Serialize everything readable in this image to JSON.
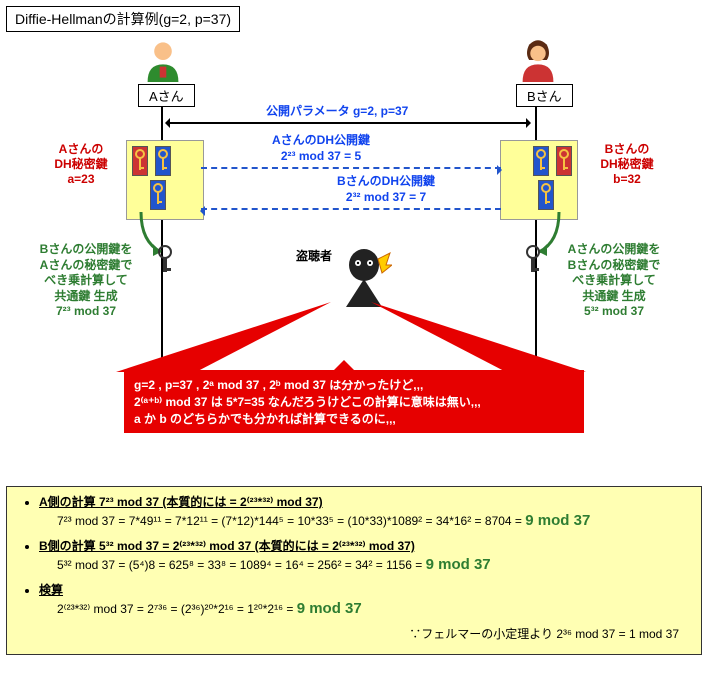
{
  "title": "Diffie-Hellmanの計算例(g=2, p=37)",
  "a_name": "Aさん",
  "b_name": "Bさん",
  "params": "公開パラメータ g=2, p=37",
  "a_sec_l1": "Aさんの",
  "a_sec_l2": "DH秘密鍵",
  "a_sec_l3": "a=23",
  "b_sec_l1": "Bさんの",
  "b_sec_l2": "DH秘密鍵",
  "b_sec_l3": "b=32",
  "a_pub_t": "AさんのDH公開鍵",
  "a_pub_v": "2²³ mod 37 = 5",
  "b_pub_t": "BさんのDH公開鍵",
  "b_pub_v": "2³² mod 37 = 7",
  "a_gen_l1": "Bさんの公開鍵を",
  "a_gen_l2": "Aさんの秘密鍵で",
  "a_gen_l3": "べき乗計算して",
  "a_gen_l4": "共通鍵 生成",
  "a_gen_v": "7²³ mod 37",
  "b_gen_l1": "Aさんの公開鍵を",
  "b_gen_l2": "Bさんの秘密鍵で",
  "b_gen_l3": "べき乗計算して",
  "b_gen_l4": "共通鍵 生成",
  "b_gen_v": "5³² mod 37",
  "eaves": "盗聴者",
  "bub_l1": "g=2 , p=37 , 2ᵃ mod 37 , 2ᵇ mod 37 は分かったけど,,,",
  "bub_l2": "2⁽ᵃ⁺ᵇ⁾ mod 37 は 5*7=35 なんだろうけどこの計算に意味は無い,,,",
  "bub_l3": "a か b のどちらかでも分かれば計算できるのに,,,",
  "calc_a_hd": "A側の計算 7²³ mod 37 (本質的には = 2⁽²³*³²⁾ mod 37)",
  "calc_a_eq": "7²³ mod 37 = 7*49¹¹ = 7*12¹¹ = (7*12)*144⁵ = 10*33⁵ = (10*33)*1089² = 34*16² = 8704 = ",
  "calc_a_ans": "9 mod 37",
  "calc_b_hd": "B側の計算 5³² mod 37 = 2⁽²³*³²⁾ mod 37 (本質的には = 2⁽²³*³²⁾ mod 37)",
  "calc_b_eq": "5³² mod 37 = (5⁴)8 = 625⁸ = 33⁸ = 1089⁴ = 16⁴ = 256² = 34² = 1156 = ",
  "calc_b_ans": "9 mod 37",
  "calc_c_hd": "検算",
  "calc_c_eq": "2⁽²³*³²⁾ mod 37 = 2⁷³⁶ = (2³⁶)²⁰*2¹⁶ = 1²⁰*2¹⁶ = ",
  "calc_c_ans": "9 mod 37",
  "fermat": "∵フェルマーの小定理より 2³⁶ mod 37 = 1 mod 37"
}
